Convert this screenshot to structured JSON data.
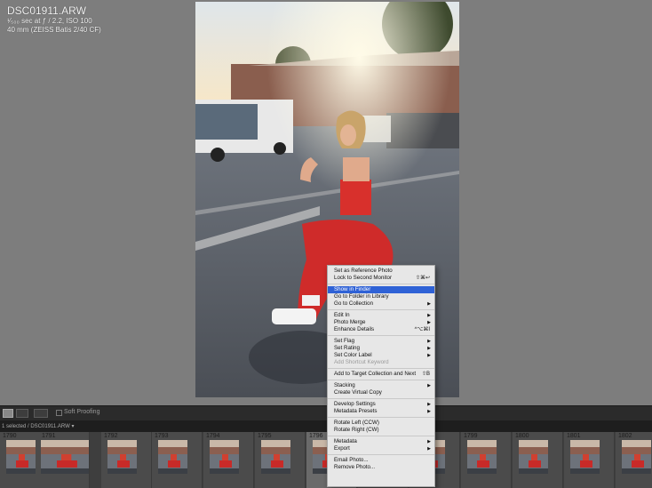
{
  "info": {
    "filename": "DSC01911.ARW",
    "exposure": "¹⁄₅₀₀ sec at ƒ / 2.2, ISO 100",
    "lens": "40 mm (ZEISS Batis 2/40 CF)"
  },
  "toolbar": {
    "soft_proofing": "Soft Proofing"
  },
  "filmstrip": {
    "selected": "1 selected / DSC01911.ARW ▾",
    "frames": [
      "1790",
      "1791",
      "1792",
      "1793",
      "1794",
      "1795",
      "1796",
      "1797",
      "1798",
      "1799",
      "1800",
      "1801",
      "1802"
    ]
  },
  "context_menu": [
    {
      "label": "Set as Reference Photo"
    },
    {
      "label": "Lock to Second Monitor",
      "shortcut": "⇧⌘↩"
    },
    {
      "label": "Show in Finder",
      "highlighted": true
    },
    {
      "label": "Go to Folder in Library"
    },
    {
      "label": "Go to Collection",
      "submenu": true
    },
    {
      "label": "Edit In",
      "submenu": true
    },
    {
      "label": "Photo Merge",
      "submenu": true
    },
    {
      "label": "Enhance Details",
      "shortcut": "^⌥⌘I"
    },
    {
      "label": "Set Flag",
      "submenu": true
    },
    {
      "label": "Set Rating",
      "submenu": true
    },
    {
      "label": "Set Color Label",
      "submenu": true
    },
    {
      "label": "Add Shortcut Keyword",
      "disabled": true
    },
    {
      "label": "Add to Target Collection and Next",
      "shortcut": "⇧B"
    },
    {
      "label": "Stacking",
      "submenu": true
    },
    {
      "label": "Create Virtual Copy"
    },
    {
      "label": "Develop Settings",
      "submenu": true
    },
    {
      "label": "Metadata Presets",
      "submenu": true
    },
    {
      "label": "Rotate Left (CCW)"
    },
    {
      "label": "Rotate Right (CW)"
    },
    {
      "label": "Metadata",
      "submenu": true
    },
    {
      "label": "Export",
      "submenu": true
    },
    {
      "label": "Email Photo..."
    },
    {
      "label": "Remove Photo..."
    }
  ],
  "colors": {
    "highlight": "#2f62d6",
    "menu_bg": "#e7e7e7",
    "app_bg": "#7d7d7d"
  }
}
